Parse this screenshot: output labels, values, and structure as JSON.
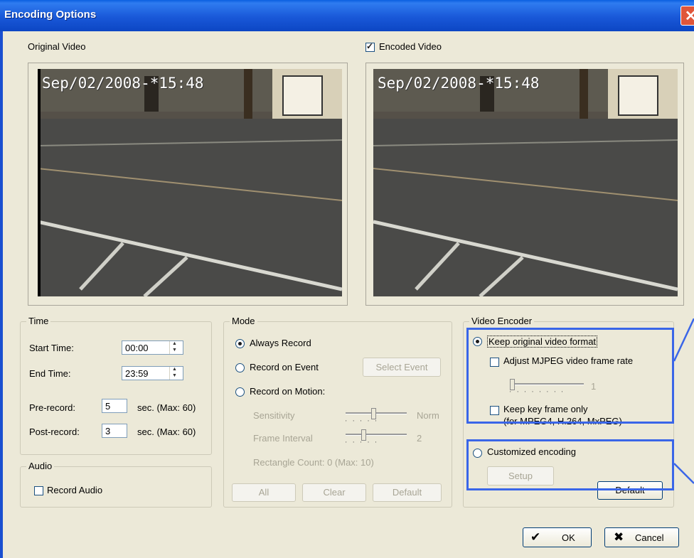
{
  "window": {
    "title": "Encoding Options",
    "close_glyph": "✕"
  },
  "video": {
    "original_label": "Original Video",
    "encoded_label": "Encoded Video",
    "encoded_checked": true,
    "timestamp": "Sep/02/2008-*15:48"
  },
  "time": {
    "legend": "Time",
    "start_label": "Start Time:",
    "start_value": "00:00",
    "end_label": "End Time:",
    "end_value": "23:59",
    "pre_label": "Pre-record:",
    "pre_value": "5",
    "post_label": "Post-record:",
    "post_value": "3",
    "sec_max": "sec. (Max: 60)"
  },
  "audio": {
    "legend": "Audio",
    "record_label": "Record Audio",
    "checked": false
  },
  "mode": {
    "legend": "Mode",
    "always": "Always Record",
    "on_event": "Record on Event",
    "select_event": "Select Event",
    "on_motion": "Record on Motion:",
    "sensitivity_label": "Sensitivity",
    "sensitivity_value": "Norm",
    "sensitivity_level": 0.45,
    "frame_interval_label": "Frame Interval",
    "frame_interval_value": "2",
    "rect_count": "Rectangle Count: 0",
    "rect_max": "(Max: 10)",
    "btn_all": "All",
    "btn_clear": "Clear",
    "btn_default": "Default",
    "selected": "always"
  },
  "encoder": {
    "legend": "Video Encoder",
    "keep_original": "Keep original video format",
    "adjust_mjpeg": "Adjust MJPEG video frame rate",
    "frame_rate_value": "1",
    "keep_key_frame": "Keep key frame only",
    "key_frame_note": "(for MPEG4, H.264, MxPEG)",
    "customized": "Customized encoding",
    "setup": "Setup",
    "default": "Default",
    "selected": "keep_original"
  },
  "footer": {
    "ok": "OK",
    "cancel": "Cancel",
    "ok_glyph": "✔",
    "cancel_glyph": "✖"
  },
  "highlight_color": "#3a66e8"
}
